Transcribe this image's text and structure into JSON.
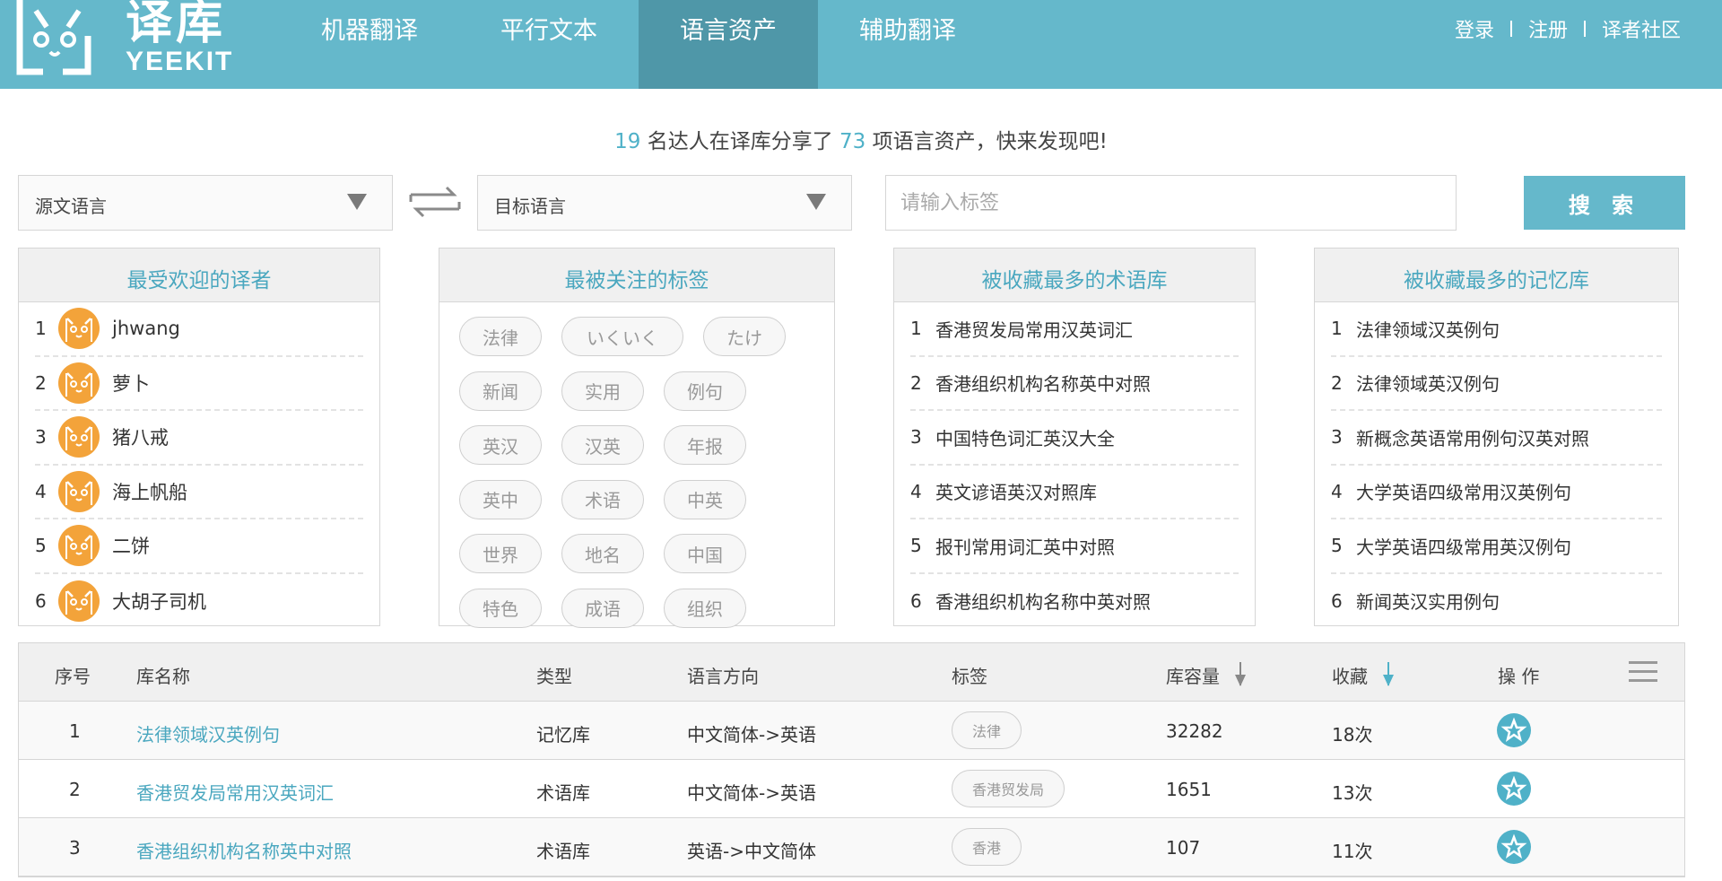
{
  "header": {
    "logo_cn": "译库",
    "logo_en": "YEEKIT",
    "nav": [
      {
        "label": "机器翻译",
        "active": false
      },
      {
        "label": "平行文本",
        "active": false
      },
      {
        "label": "语言资产",
        "active": true
      },
      {
        "label": "辅助翻译",
        "active": false
      }
    ],
    "login": "登录",
    "register": "注册",
    "community": "译者社区"
  },
  "stats": {
    "users": "19",
    "text1": " 名达人在译库分享了 ",
    "assets": "73",
    "text2": " 项语言资产，快来发现吧!"
  },
  "search": {
    "source_lang": "源文语言",
    "target_lang": "目标语言",
    "tag_placeholder": "请输入标签",
    "button": "搜 索"
  },
  "panels": {
    "translators": {
      "title": "最受欢迎的译者",
      "items": [
        {
          "rank": "1",
          "name": "jhwang"
        },
        {
          "rank": "2",
          "name": "萝卜"
        },
        {
          "rank": "3",
          "name": "猪八戒"
        },
        {
          "rank": "4",
          "name": "海上帆船"
        },
        {
          "rank": "5",
          "name": "二饼"
        },
        {
          "rank": "6",
          "name": "大胡子司机"
        }
      ]
    },
    "tags": {
      "title": "最被关注的标签",
      "rows": [
        [
          "法律",
          "いくいく",
          "たけ"
        ],
        [
          "新闻",
          "实用",
          "例句"
        ],
        [
          "英汉",
          "汉英",
          "年报"
        ],
        [
          "英中",
          "术语",
          "中英"
        ],
        [
          "世界",
          "地名",
          "中国"
        ],
        [
          "特色",
          "成语",
          "组织"
        ]
      ]
    },
    "termbases": {
      "title": "被收藏最多的术语库",
      "items": [
        {
          "rank": "1",
          "name": "香港贸发局常用汉英词汇"
        },
        {
          "rank": "2",
          "name": "香港组织机构名称英中对照"
        },
        {
          "rank": "3",
          "name": "中国特色词汇英汉大全"
        },
        {
          "rank": "4",
          "name": "英文谚语英汉对照库"
        },
        {
          "rank": "5",
          "name": "报刊常用词汇英中对照"
        },
        {
          "rank": "6",
          "name": "香港组织机构名称中英对照"
        }
      ]
    },
    "memories": {
      "title": "被收藏最多的记忆库",
      "items": [
        {
          "rank": "1",
          "name": "法律领域汉英例句"
        },
        {
          "rank": "2",
          "name": "法律领域英汉例句"
        },
        {
          "rank": "3",
          "name": "新概念英语常用例句汉英对照"
        },
        {
          "rank": "4",
          "name": "大学英语四级常用汉英例句"
        },
        {
          "rank": "5",
          "name": "大学英语四级常用英汉例句"
        },
        {
          "rank": "6",
          "name": "新闻英汉实用例句"
        }
      ]
    }
  },
  "table": {
    "headers": {
      "no": "序号",
      "name": "库名称",
      "type": "类型",
      "direction": "语言方向",
      "tag": "标签",
      "size": "库容量",
      "favorites": "收藏",
      "actions": "操 作"
    },
    "rows": [
      {
        "no": "1",
        "name": "法律领域汉英例句",
        "type": "记忆库",
        "direction": "中文简体->英语",
        "tag": "法律",
        "size": "32282",
        "favorites": "18次"
      },
      {
        "no": "2",
        "name": "香港贸发局常用汉英词汇",
        "type": "术语库",
        "direction": "中文简体->英语",
        "tag": "香港贸发局",
        "size": "1651",
        "favorites": "13次"
      },
      {
        "no": "3",
        "name": "香港组织机构名称英中对照",
        "type": "术语库",
        "direction": "英语->中文简体",
        "tag": "香港",
        "size": "107",
        "favorites": "11次"
      }
    ]
  },
  "colors": {
    "header_bg": "#65b8cb",
    "nav_active": "#4f97a8",
    "accent_text": "#4aa7bf",
    "avatar": "#f3a33a"
  }
}
